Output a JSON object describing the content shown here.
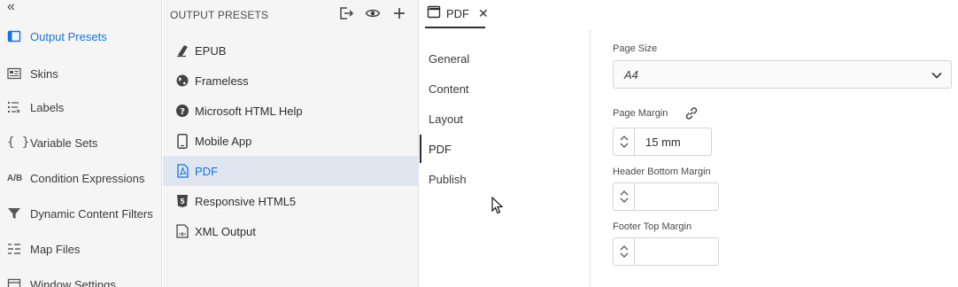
{
  "sidebar": {
    "collapse_icon": "chevron-double-left-icon",
    "items": [
      {
        "label": "Output Presets",
        "icon": "presets-icon",
        "active": true
      },
      {
        "label": "Skins",
        "icon": "skins-icon"
      },
      {
        "label": "Labels",
        "icon": "labels-icon"
      },
      {
        "label": "Variable Sets",
        "icon": "braces-icon"
      },
      {
        "label": "Condition Expressions",
        "icon": "ab-icon"
      },
      {
        "label": "Dynamic Content Filters",
        "icon": "filter-icon"
      },
      {
        "label": "Map Files",
        "icon": "map-files-icon"
      },
      {
        "label": "Window Settings",
        "icon": "window-icon"
      }
    ]
  },
  "presets": {
    "heading": "OUTPUT PRESETS",
    "items": [
      {
        "label": "EPUB",
        "icon": "epub-icon"
      },
      {
        "label": "Frameless",
        "icon": "globe-icon"
      },
      {
        "label": "Microsoft HTML Help",
        "icon": "help-icon"
      },
      {
        "label": "Mobile App",
        "icon": "mobile-icon"
      },
      {
        "label": "PDF",
        "icon": "pdf-icon",
        "selected": true
      },
      {
        "label": "Responsive HTML5",
        "icon": "html5-icon"
      },
      {
        "label": "XML Output",
        "icon": "xml-icon"
      }
    ]
  },
  "tab": {
    "label": "PDF"
  },
  "sections": [
    "General",
    "Content",
    "Layout",
    "PDF",
    "Publish"
  ],
  "form": {
    "page_size_label": "Page Size",
    "page_size_value": "A4",
    "page_margin_label": "Page Margin",
    "page_margin_value": "15 mm",
    "header_bottom_margin_label": "Header Bottom Margin",
    "header_bottom_margin_value": "",
    "footer_top_margin_label": "Footer Top Margin",
    "footer_top_margin_value": ""
  },
  "colors": {
    "accent": "#1473e6",
    "selected_row": "#dfe6ef",
    "panel": "#f5f5f5"
  }
}
